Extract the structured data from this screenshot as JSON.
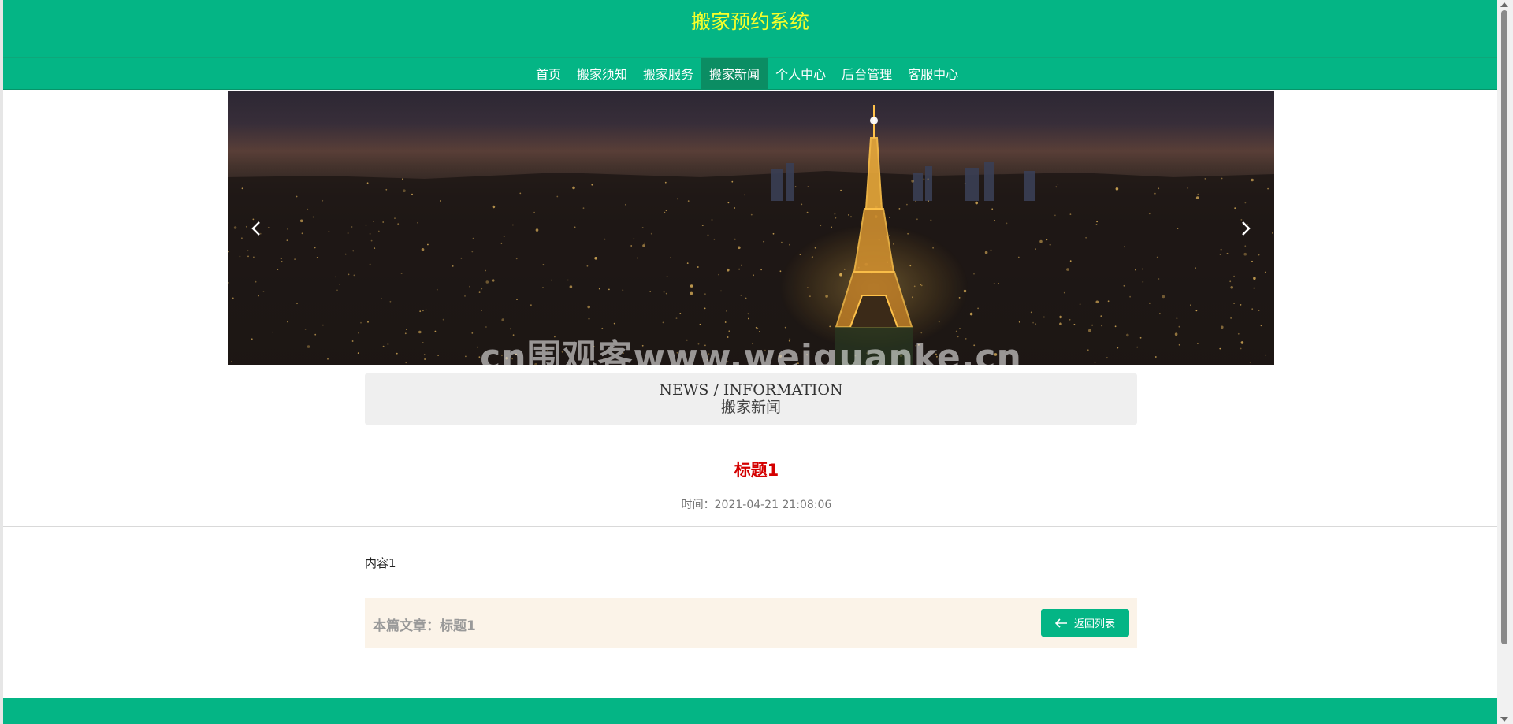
{
  "header": {
    "site_title": "搬家预约系统"
  },
  "nav": {
    "items": [
      {
        "label": "首页",
        "active": false
      },
      {
        "label": "搬家须知",
        "active": false
      },
      {
        "label": "搬家服务",
        "active": false
      },
      {
        "label": "搬家新闻",
        "active": true
      },
      {
        "label": "个人中心",
        "active": false
      },
      {
        "label": "后台管理",
        "active": false
      },
      {
        "label": "客服中心",
        "active": false
      }
    ]
  },
  "banner": {
    "watermark": "cn围观客www.weiguanke.cn",
    "prev_icon": "chevron-left-icon",
    "next_icon": "chevron-right-icon"
  },
  "section": {
    "title_en": "NEWS / INFORMATION",
    "title_cn": "搬家新闻"
  },
  "article": {
    "title": "标题1",
    "time": "时间：2021-04-21 21:08:06",
    "content": "内容1",
    "current_label": "本篇文章：标题1",
    "back_label": "返回列表",
    "back_icon": "arrow-left-icon"
  },
  "colors": {
    "brand": "#04b585",
    "brand_dark": "#0b8d63",
    "title_yellow": "#f7ff2a",
    "article_red": "#d40000"
  }
}
